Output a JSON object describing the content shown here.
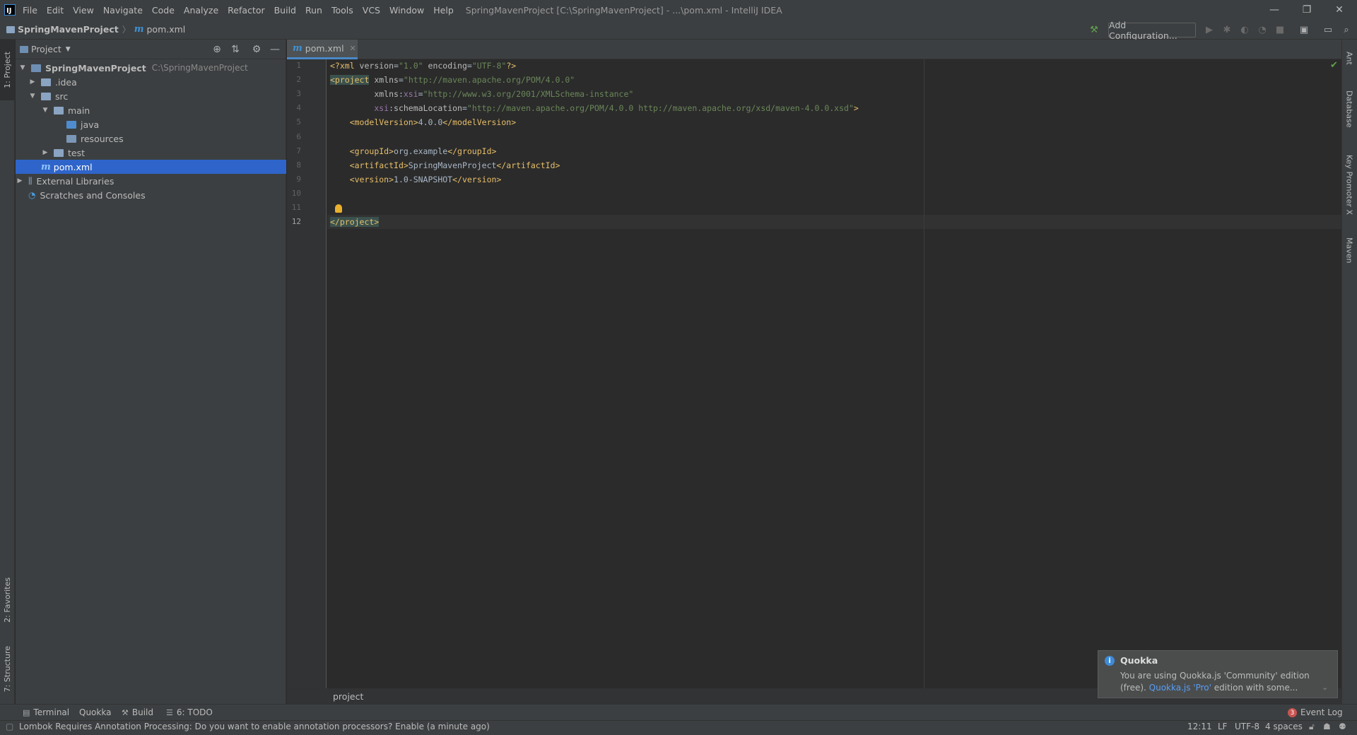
{
  "titlebar": {
    "menu": [
      "File",
      "Edit",
      "View",
      "Navigate",
      "Code",
      "Analyze",
      "Refactor",
      "Build",
      "Run",
      "Tools",
      "VCS",
      "Window",
      "Help"
    ],
    "window_title": "SpringMavenProject [C:\\SpringMavenProject] - ...\\pom.xml - IntelliJ IDEA",
    "logo_letter": "IJ",
    "minimize": "—",
    "restore": "❐",
    "close": "✕"
  },
  "navbar": {
    "project": "SpringMavenProject",
    "separator": "〉",
    "file_icon": "m",
    "file": "pom.xml",
    "add_configuration": "Add Configuration..."
  },
  "left_stripe": {
    "project_tab": "1: Project",
    "favorites_tab": "2: Favorites",
    "structure_tab": "7: Structure"
  },
  "right_stripe": {
    "ant": "Ant",
    "database": "Database",
    "key_promoter": "Key Promoter X",
    "maven": "Maven"
  },
  "project_panel": {
    "title": "Project",
    "tree": [
      {
        "label": "SpringMavenProject",
        "hint": "C:\\SpringMavenProject",
        "expanded": "▼",
        "bold": true
      },
      {
        "label": ".idea",
        "expanded": "▶"
      },
      {
        "label": "src",
        "expanded": "▼"
      },
      {
        "label": "main",
        "expanded": "▼"
      },
      {
        "label": "java",
        "expanded": ""
      },
      {
        "label": "resources",
        "expanded": ""
      },
      {
        "label": "test",
        "expanded": "▶"
      },
      {
        "label": "pom.xml",
        "icon": "m",
        "expanded": "",
        "selected": true
      },
      {
        "label": "External Libraries",
        "expanded": "▶"
      },
      {
        "label": "Scratches and Consoles",
        "expanded": ""
      }
    ]
  },
  "editor": {
    "tab_label": "pom.xml",
    "tab_icon": "m",
    "tab_close": "✕",
    "line_numbers": [
      "1",
      "2",
      "3",
      "4",
      "5",
      "6",
      "7",
      "8",
      "9",
      "10",
      "11",
      "12"
    ],
    "lines": [
      {
        "parts": [
          {
            "c": "tag",
            "t": "<?xml "
          },
          {
            "c": "attr",
            "t": "version"
          },
          {
            "c": "txt",
            "t": "="
          },
          {
            "c": "str",
            "t": "\"1.0\""
          },
          {
            "c": "txt",
            "t": " "
          },
          {
            "c": "attr",
            "t": "encoding"
          },
          {
            "c": "txt",
            "t": "="
          },
          {
            "c": "str",
            "t": "\"UTF-8\""
          },
          {
            "c": "tag",
            "t": "?>"
          }
        ]
      },
      {
        "parts": [
          {
            "c": "hl-tag",
            "t": "<project"
          },
          {
            "c": "txt",
            "t": " "
          },
          {
            "c": "attr",
            "t": "xmlns"
          },
          {
            "c": "txt",
            "t": "="
          },
          {
            "c": "str",
            "t": "\"http://maven.apache.org/POM/4.0.0\""
          }
        ]
      },
      {
        "parts": [
          {
            "c": "txt",
            "t": "         "
          },
          {
            "c": "attr",
            "t": "xmlns"
          },
          {
            "c": "txt",
            "t": ":"
          },
          {
            "c": "ns",
            "t": "xsi"
          },
          {
            "c": "txt",
            "t": "="
          },
          {
            "c": "str",
            "t": "\"http://www.w3.org/2001/XMLSchema-instance\""
          }
        ]
      },
      {
        "parts": [
          {
            "c": "txt",
            "t": "         "
          },
          {
            "c": "ns",
            "t": "xsi"
          },
          {
            "c": "txt",
            "t": ":"
          },
          {
            "c": "attr",
            "t": "schemaLocation"
          },
          {
            "c": "txt",
            "t": "="
          },
          {
            "c": "str",
            "t": "\"http://maven.apache.org/POM/4.0.0 http://maven.apache.org/xsd/maven-4.0.0.xsd\""
          },
          {
            "c": "tag",
            "t": ">"
          }
        ]
      },
      {
        "parts": [
          {
            "c": "txt",
            "t": "    "
          },
          {
            "c": "tag",
            "t": "<modelVersion>"
          },
          {
            "c": "txt",
            "t": "4.0.0"
          },
          {
            "c": "tag",
            "t": "</modelVersion>"
          }
        ]
      },
      {
        "parts": []
      },
      {
        "parts": [
          {
            "c": "txt",
            "t": "    "
          },
          {
            "c": "tag",
            "t": "<groupId>"
          },
          {
            "c": "txt",
            "t": "org.example"
          },
          {
            "c": "tag",
            "t": "</groupId>"
          }
        ]
      },
      {
        "parts": [
          {
            "c": "txt",
            "t": "    "
          },
          {
            "c": "tag",
            "t": "<artifactId>"
          },
          {
            "c": "txt",
            "t": "SpringMavenProject"
          },
          {
            "c": "tag",
            "t": "</artifactId>"
          }
        ]
      },
      {
        "parts": [
          {
            "c": "txt",
            "t": "    "
          },
          {
            "c": "tag",
            "t": "<version>"
          },
          {
            "c": "txt",
            "t": "1.0-SNAPSHOT"
          },
          {
            "c": "tag",
            "t": "</version>"
          }
        ]
      },
      {
        "parts": []
      },
      {
        "parts": []
      },
      {
        "parts": [
          {
            "c": "hl-tag",
            "t": "</project>"
          }
        ]
      }
    ],
    "breadcrumb": "project"
  },
  "bottom_tabs": {
    "terminal": "Terminal",
    "quokka": "Quokka",
    "build": "Build",
    "todo": "6: TODO",
    "event_log": "Event Log",
    "event_count": "3"
  },
  "status": {
    "message": "Lombok Requires Annotation Processing: Do you want to enable annotation processors? Enable (a minute ago)",
    "position": "12:11",
    "line_sep": "LF",
    "encoding": "UTF-8",
    "indent": "4 spaces"
  },
  "notification": {
    "icon": "i",
    "title": "Quokka",
    "body_prefix": "You are using Quokka.js 'Community' edition (free). ",
    "link": "Quokka.js 'Pro'",
    "body_suffix": " edition with some...",
    "expand": "⌄"
  },
  "colors": {
    "accent": "#2f65ca",
    "background": "#2b2b2b",
    "panel": "#3c3f41",
    "tag": "#e8bf6a",
    "string": "#6a8759"
  }
}
